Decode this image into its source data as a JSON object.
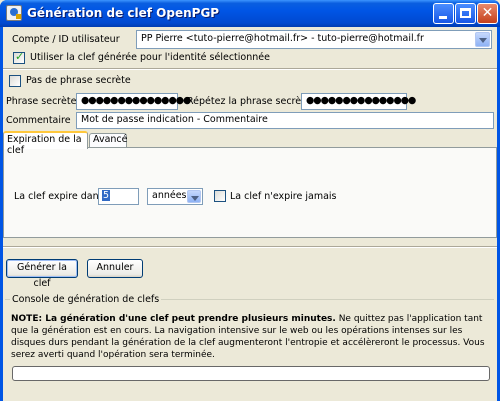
{
  "window": {
    "title": "Génération de clef OpenPGP",
    "close_glyph": "✕"
  },
  "account": {
    "label": "Compte / ID utilisateur",
    "selected": "PP Pierre <tuto-pierre@hotmail.fr> - tuto-pierre@hotmail.fr",
    "use_key_label": "Utiliser la clef générée pour l'identité sélectionnée",
    "use_key_checked": true
  },
  "passphrase": {
    "no_passphrase_label": "Pas de phrase secrète",
    "no_passphrase_checked": false,
    "label": "Phrase secrète",
    "value": "●●●●●●●●●●●●●●●",
    "repeat_label": "Répétez la phrase secrète",
    "repeat_value": "●●●●●●●●●●●●●●●"
  },
  "comment": {
    "label": "Commentaire",
    "value": "Mot de passe indication - Commentaire"
  },
  "tabs": [
    {
      "label": "Expiration de la clef",
      "active": true
    },
    {
      "label": "Avancé",
      "active": false
    }
  ],
  "expiry": {
    "label": "La clef expire dans",
    "value": "5",
    "unit": "années",
    "never_label": "La clef n'expire jamais",
    "never_checked": false
  },
  "buttons": {
    "generate": "Générer la clef",
    "cancel": "Annuler"
  },
  "console": {
    "label": "Console de génération de clefs",
    "note_bold": "NOTE: La génération d'une clef peut prendre plusieurs minutes.",
    "note_text": " Ne quittez pas l'application tant que la génération est en cours. La navigation intensive sur le web ou les opérations intenses sur les disques durs pendant la génération de la clef augmenteront l'entropie et accélèreront le processus. Vous serez averti quand l'opération sera terminée.",
    "progress": 0
  },
  "colors": {
    "titlebar": "#0055e5",
    "face": "#ece9d8",
    "tab_highlight": "#ffc83c"
  }
}
